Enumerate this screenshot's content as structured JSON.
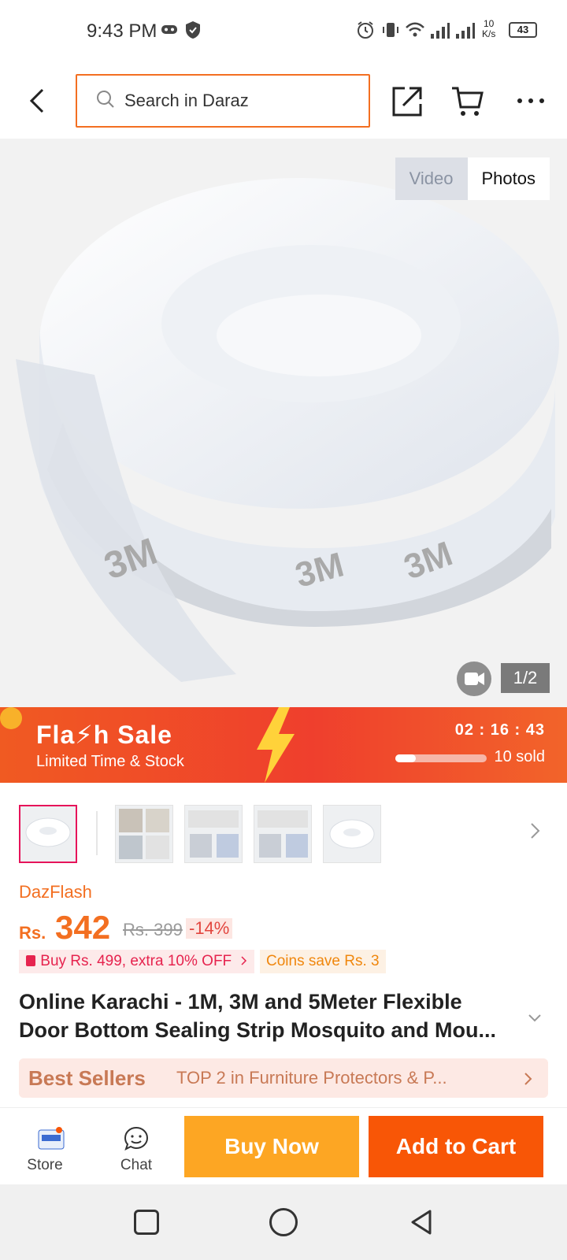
{
  "status_bar": {
    "time": "9:43 PM",
    "speed_value": "10",
    "speed_unit": "K/s",
    "battery": "43",
    "icons": [
      "gamepad-icon",
      "shield-icon",
      "alarm-icon",
      "vibrate-icon",
      "wifi-icon",
      "signal-icon",
      "signal-icon"
    ]
  },
  "top_bar": {
    "search_placeholder": "Search in Daraz",
    "icons": [
      "back-icon",
      "search-icon",
      "share-icon",
      "cart-icon",
      "more-icon"
    ],
    "accent_color": "#f36f21"
  },
  "hero": {
    "tabs": [
      "Video",
      "Photos"
    ],
    "counter": "1/2"
  },
  "flash_sale": {
    "title": "Fla⚡h Sale",
    "subtitle": "Limited Time & Stock",
    "timer": "02 : 16 : 43",
    "sold": "10 sold",
    "progress": 0.22
  },
  "thumbnails": {
    "count": 5
  },
  "product": {
    "brand": "DazFlash",
    "currency": "Rs.",
    "price": "342",
    "old_price": "Rs. 399",
    "discount": "-14%",
    "promo_voucher": "Buy Rs. 499, extra 10% OFF",
    "promo_coins": "Coins save Rs. 3",
    "title_line1": "Online Karachi - 1M, 3M and 5Meter Flexible",
    "title_line2": "Door Bottom Sealing Strip Mosquito and Mou...",
    "best_sellers_label": "Best Sellers",
    "best_sellers_text": "TOP 2 in Furniture Protectors & P..."
  },
  "action_bar": {
    "store_label": "Store",
    "chat_label": "Chat",
    "buy_now": "Buy Now",
    "add_to_cart": "Add to Cart",
    "buy_color": "#fda623",
    "cart_color": "#f85606"
  }
}
